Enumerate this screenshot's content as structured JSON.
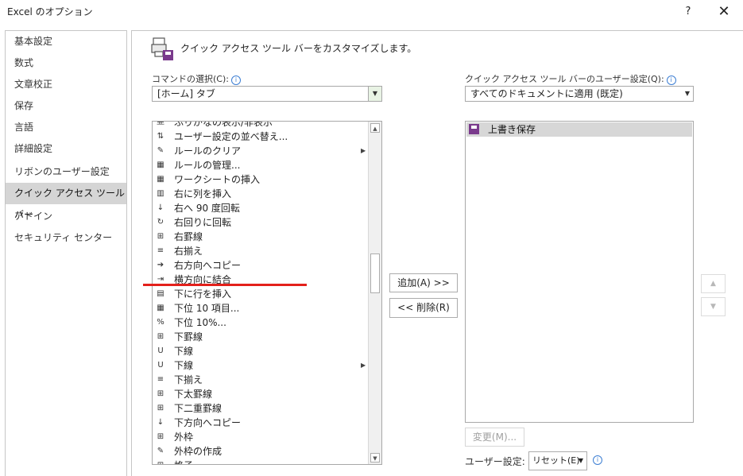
{
  "window": {
    "title": "Excel のオプション",
    "help": "?",
    "close": "✕"
  },
  "sidebar": {
    "items": [
      {
        "label": "基本設定",
        "active": false
      },
      {
        "label": "数式",
        "active": false
      },
      {
        "label": "文章校正",
        "active": false
      },
      {
        "label": "保存",
        "active": false
      },
      {
        "label": "言語",
        "active": false
      },
      {
        "label": "詳細設定",
        "active": false
      },
      {
        "label": "リボンのユーザー設定",
        "active": false
      },
      {
        "label": "クイック アクセス ツール バー",
        "active": true
      },
      {
        "label": "アドイン",
        "active": false
      },
      {
        "label": "セキュリティ センター",
        "active": false
      }
    ]
  },
  "header": {
    "text": "クイック アクセス ツール バーをカスタマイズします。",
    "icon": "customize-toolbar-icon"
  },
  "commands": {
    "label": "コマンドの選択(C):",
    "info": "i",
    "selected": "[ホーム] タブ",
    "dropdown_icon": "▼",
    "items": [
      {
        "label": "ふりがなの表示/非表示",
        "icon": "亜"
      },
      {
        "label": "ユーザー設定の並べ替え...",
        "icon": "⇅"
      },
      {
        "label": "ルールのクリア",
        "icon": "✎",
        "submenu": "▶"
      },
      {
        "label": "ルールの管理...",
        "icon": "▦"
      },
      {
        "label": "ワークシートの挿入",
        "icon": "▦"
      },
      {
        "label": "右に列を挿入",
        "icon": "▥"
      },
      {
        "label": "右へ 90 度回転",
        "icon": "↓"
      },
      {
        "label": "右回りに回転",
        "icon": "↻"
      },
      {
        "label": "右罫線",
        "icon": "⊞"
      },
      {
        "label": "右揃え",
        "icon": "≡"
      },
      {
        "label": "右方向へコピー",
        "icon": "➔"
      },
      {
        "label": "横方向に結合",
        "icon": "⇥"
      },
      {
        "label": "下に行を挿入",
        "icon": "▤"
      },
      {
        "label": "下位 10 項目...",
        "icon": "▦"
      },
      {
        "label": "下位 10%...",
        "icon": "%"
      },
      {
        "label": "下罫線",
        "icon": "⊞"
      },
      {
        "label": "下線",
        "icon": "U"
      },
      {
        "label": "下線",
        "icon": "U",
        "submenu": "▶"
      },
      {
        "label": "下揃え",
        "icon": "≡"
      },
      {
        "label": "下太罫線",
        "icon": "⊞"
      },
      {
        "label": "下二重罫線",
        "icon": "⊞"
      },
      {
        "label": "下方向へコピー",
        "icon": "↓"
      },
      {
        "label": "外枠",
        "icon": "⊞"
      },
      {
        "label": "外枠の作成",
        "icon": "✎"
      },
      {
        "label": "格子",
        "icon": "⊞"
      }
    ],
    "scroll_up": "▲",
    "scroll_down": "▼"
  },
  "actions": {
    "add": "追加(A) >>",
    "remove": "<< 削除(R)"
  },
  "qat": {
    "label": "クイック アクセス ツール バーのユーザー設定(Q):",
    "info": "i",
    "selected": "すべてのドキュメントに適用 (既定)",
    "dropdown_icon": "▼",
    "items": [
      {
        "label": "上書き保存",
        "icon": "save-icon"
      }
    ],
    "move_up": "▲",
    "move_down": "▼",
    "modify": "変更(M)...",
    "custom_label": "ユーザー設定:",
    "reset": "リセット(E)",
    "reset_arrow": "▼"
  }
}
